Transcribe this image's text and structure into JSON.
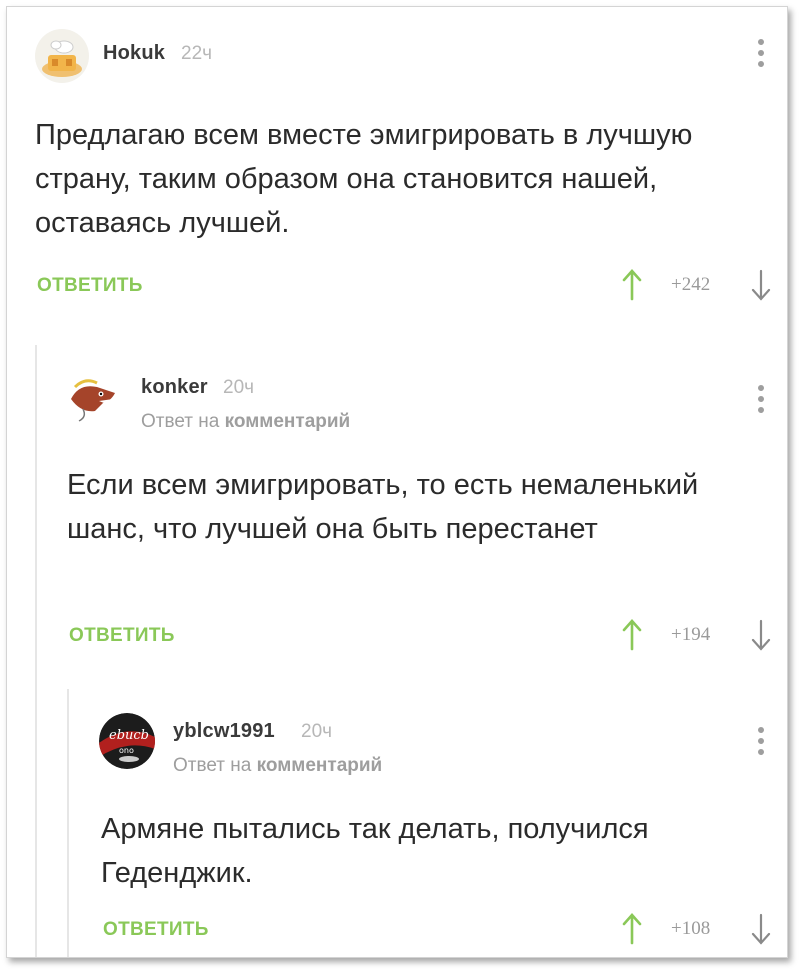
{
  "colors": {
    "accent_green": "#8ac858",
    "text": "#2b2b2b",
    "muted": "#9e9e9e",
    "thread_line": "#e6e6e6"
  },
  "icons": {
    "upvote": "arrow-up-icon",
    "downvote": "arrow-down-icon",
    "menu": "kebab-menu-icon"
  },
  "comments": [
    {
      "username": "Hokuk",
      "time": "22ч",
      "reply_to": null,
      "text": "Предлагаю всем вместе эмигрировать в лучшую страну, таким образом она становится нашей, оставаясь лучшей.",
      "reply_label": "ОТВЕТИТЬ",
      "rating": "+242"
    },
    {
      "username": "konker",
      "time": "20ч",
      "reply_to": {
        "prefix": "Ответ на",
        "target": "комментарий"
      },
      "text": "Если всем эмигрировать, то есть немаленький шанс, что лучшей она быть перестанет",
      "reply_label": "ОТВЕТИТЬ",
      "rating": "+194"
    },
    {
      "username": "yblcw1991",
      "time": "20ч",
      "reply_to": {
        "prefix": "Ответ на",
        "target": "комментарий"
      },
      "text": "Армяне пытались так делать, получился Геденджик.",
      "reply_label": "ОТВЕТИТЬ",
      "rating": "+108"
    }
  ]
}
